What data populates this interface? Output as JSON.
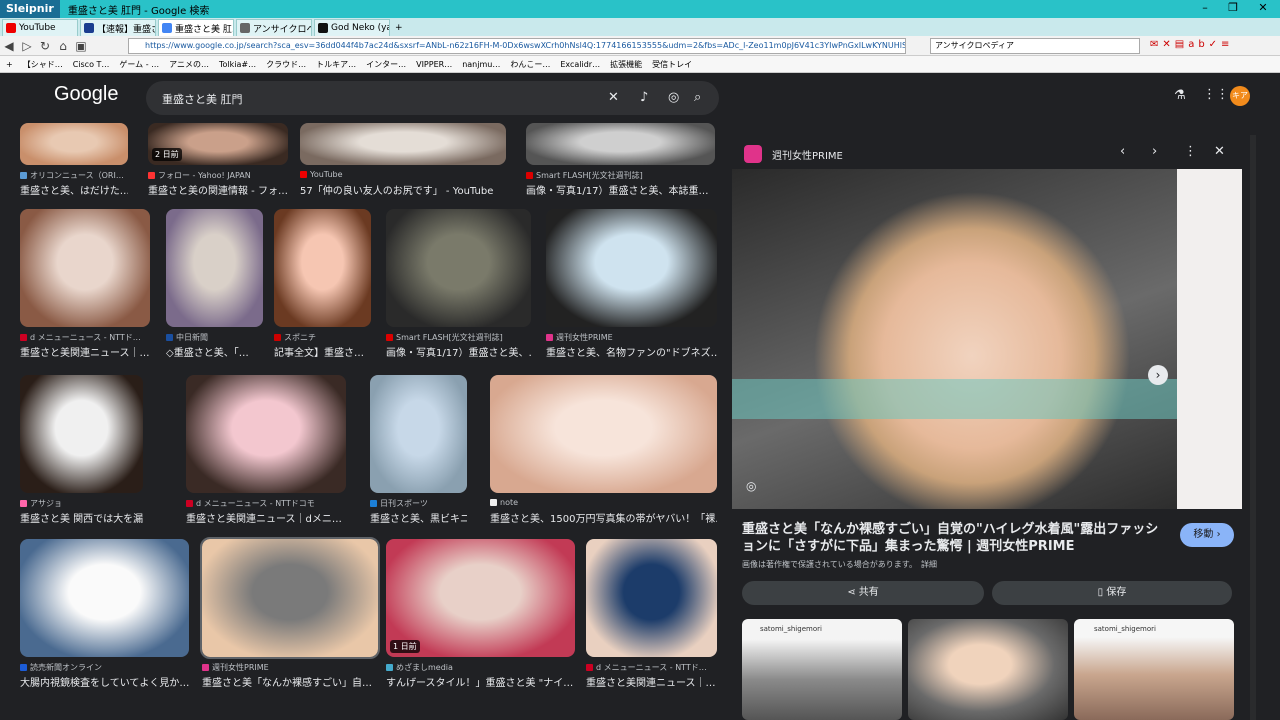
{
  "browser": {
    "brand": "Sleipnir",
    "window_title": "重盛さと美 肛門 - Google 検索",
    "tabs": [
      {
        "label": "YouTube",
        "color": "#e00"
      },
      {
        "label": "【速報】重盛さと…",
        "color": "#1a3d8f"
      },
      {
        "label": "重盛さと美 肛…",
        "color": "#4285f4"
      },
      {
        "label": "アンサイクロペディ…",
        "color": "#666"
      },
      {
        "label": "God Neko (yaye…",
        "color": "#111"
      }
    ],
    "url": "https://www.google.co.jp/search?sca_esv=36dd044f4b7ac24d&sxsrf=ANbL-n62z16FH-M-0Dx6wswXCrh0hNsl4Q:1774166153555&udm=2&fbs=ADc_l-Zeo11m0pJ6V41c3YIwPnGxILwKYNUHlSLMKumds4-l3Jnz",
    "search_box": "アンサイクロペディア",
    "bookmarks": [
      "【シャド…",
      "Cisco T…",
      "ゲーム - …",
      "アニメの…",
      "Tolkia#…",
      "クラウド…",
      "トルキア…",
      "インター…",
      "VIPPER…",
      "nanjmu…",
      "わんこー…",
      "Excalidr…",
      "拡張機能",
      "受信トレイ"
    ]
  },
  "google": {
    "logo": "Google",
    "query": "重盛さと美 肛門",
    "avatar": "キア"
  },
  "grid": [
    {
      "src": "オリコンニュース（ORI…",
      "cap": "重盛さと美、はだけた…",
      "fc": "#5b9bd5",
      "c1": "#e8c9b2",
      "c2": "#c98f6b"
    },
    {
      "src": "フォロー - Yahoo! JAPAN",
      "cap": "重盛さと美の関連情報 - フォ…",
      "fc": "#f33",
      "c1": "#caa08a",
      "c2": "#3a2a22",
      "badge": "2 日前"
    },
    {
      "src": "YouTube",
      "cap": "57「仲の良い友人のお尻です」 - YouTube",
      "fc": "#e00",
      "c1": "#e4ddd6",
      "c2": "#7a6a60"
    },
    {
      "src": "Smart FLASH[光文社週刊誌]",
      "cap": "画像・写真1/17）重盛さと美、本誌重…",
      "fc": "#d00",
      "c1": "#cfcfcf",
      "c2": "#555"
    },
    {
      "src": "d メニューニュース - NTTド…",
      "cap": "重盛さと美関連ニュース｜…",
      "fc": "#c02",
      "c1": "#e9d6cc",
      "c2": "#8a5a45"
    },
    {
      "src": "中日新聞",
      "cap": "◇重盛さと美、「…",
      "fc": "#1a4fa0",
      "c1": "#d9d0c8",
      "c2": "#7b6b8b"
    },
    {
      "src": "スポニチ",
      "cap": "記事全文】重盛さ…",
      "fc": "#c00",
      "c1": "#f6c6b2",
      "c2": "#6b3a22"
    },
    {
      "src": "Smart FLASH[光文社週刊誌]",
      "cap": "画像・写真1/17）重盛さと美、…",
      "fc": "#d00",
      "c1": "#7a7a6a",
      "c2": "#2a2a2a"
    },
    {
      "src": "週刊女性PRIME",
      "cap": "重盛さと美、名物ファンの\"ドブネズ…",
      "fc": "#e0338a",
      "c1": "#cfe3ef",
      "c2": "#222"
    },
    {
      "src": "アサジョ",
      "cap": "重盛さと美 関西では大を漏ら…",
      "fc": "#f6a",
      "c1": "#f0f0f0",
      "c2": "#2a1e18"
    },
    {
      "src": "d メニューニュース - NTTドコモ",
      "cap": "重盛さと美関連ニュース｜dメニ…",
      "fc": "#c02",
      "c1": "#f3c7cf",
      "c2": "#3a2a25"
    },
    {
      "src": "日刊スポーツ",
      "cap": "重盛さと美、黒ビキニ…",
      "fc": "#1c7fd6",
      "c1": "#c7d8e8",
      "c2": "#8aa0b0"
    },
    {
      "src": "note",
      "cap": "重盛さと美、1500万円写真集の帯がヤバい！「裸…",
      "fc": "#eee",
      "c1": "#f7e4da",
      "c2": "#d8a890"
    },
    {
      "src": "読売新聞オンライン",
      "cap": "大腸内視鏡検査をしていてよく見か…",
      "fc": "#1c5cd6",
      "c1": "#fafafa",
      "c2": "#4a6a90"
    },
    {
      "src": "週刊女性PRIME",
      "cap": "重盛さと美「なんか裸感すごい」自…",
      "fc": "#e0338a",
      "c1": "#7a7a7a",
      "c2": "#e9c7a8"
    },
    {
      "src": "めざましmedia",
      "cap": "すんげースタイル！」重盛さと美 \"ナイ…",
      "fc": "#4ac",
      "c1": "#e8d0c8",
      "c2": "#c23a55",
      "badge": "1 日前"
    },
    {
      "src": "d メニューニュース - NTTド…",
      "cap": "重盛さと美関連ニュース｜…",
      "fc": "#c02",
      "c1": "#1c3c6a",
      "c2": "#e9d0c0"
    }
  ],
  "panel": {
    "source": "週刊女性PRIME",
    "title": "重盛さと美「なんか裸感すごい」自覚の\"ハイレグ水着風\"露出ファッションに「さすがに下品」集まった驚愕 | 週刊女性PRIME",
    "notice": "画像は著作権で保護されている場合があります。",
    "notice_link": "詳細",
    "go": "移動 ›",
    "share": "共有",
    "save": "保存",
    "thumbs": [
      {
        "user": "satomi_shigemori"
      },
      {
        "user": ""
      },
      {
        "user": "satomi_shigemori"
      }
    ]
  },
  "colors": {
    "bg": "#202124",
    "surface": "#303134",
    "accent": "#8ab4f8",
    "brand_title": "#29c2c8"
  }
}
